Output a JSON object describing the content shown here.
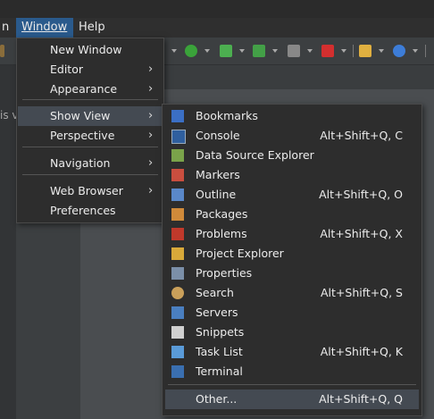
{
  "menubar": {
    "partial_item": "n",
    "window": "Window",
    "help": "Help"
  },
  "left_partial_text": "is v",
  "window_menu": [
    {
      "label": "New Window"
    },
    {
      "label": "Editor",
      "submenu": true
    },
    {
      "label": "Appearance",
      "submenu": true
    },
    {
      "label": "Show View",
      "submenu": true,
      "highlighted": true
    },
    {
      "label": "Perspective",
      "submenu": true
    },
    {
      "label": "Navigation",
      "submenu": true
    },
    {
      "label": "Web Browser",
      "submenu": true
    },
    {
      "label": "Preferences"
    }
  ],
  "show_view_menu": [
    {
      "label": "Bookmarks",
      "shortcut": "",
      "icon": "bookmarks-icon"
    },
    {
      "label": "Console",
      "shortcut": "Alt+Shift+Q, C",
      "icon": "console-icon"
    },
    {
      "label": "Data Source Explorer",
      "shortcut": "",
      "icon": "data-source-explorer-icon"
    },
    {
      "label": "Markers",
      "shortcut": "",
      "icon": "markers-icon"
    },
    {
      "label": "Outline",
      "shortcut": "Alt+Shift+Q, O",
      "icon": "outline-icon"
    },
    {
      "label": "Packages",
      "shortcut": "",
      "icon": "packages-icon"
    },
    {
      "label": "Problems",
      "shortcut": "Alt+Shift+Q, X",
      "icon": "problems-icon"
    },
    {
      "label": "Project Explorer",
      "shortcut": "",
      "icon": "project-explorer-icon"
    },
    {
      "label": "Properties",
      "shortcut": "",
      "icon": "properties-icon"
    },
    {
      "label": "Search",
      "shortcut": "Alt+Shift+Q, S",
      "icon": "search-icon"
    },
    {
      "label": "Servers",
      "shortcut": "",
      "icon": "servers-icon"
    },
    {
      "label": "Snippets",
      "shortcut": "",
      "icon": "snippets-icon"
    },
    {
      "label": "Task List",
      "shortcut": "Alt+Shift+Q, K",
      "icon": "task-list-icon"
    },
    {
      "label": "Terminal",
      "shortcut": "",
      "icon": "terminal-icon"
    },
    {
      "label": "Other...",
      "shortcut": "Alt+Shift+Q, Q",
      "icon": "",
      "highlighted": true
    }
  ],
  "colors": {
    "menu_bg": "#2d2d2d",
    "highlight": "#444a52",
    "active_menu": "#2a5a8c"
  }
}
